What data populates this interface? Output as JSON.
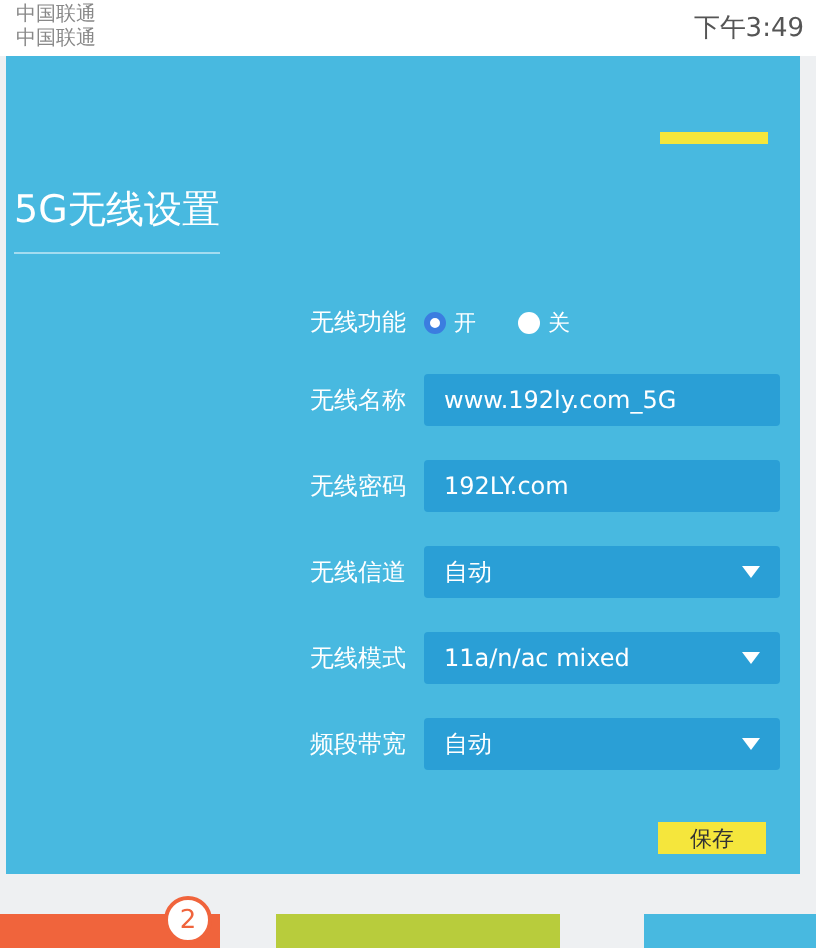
{
  "status_bar": {
    "carriers": [
      "中国联通",
      "中国联通"
    ],
    "time": "下午3:49"
  },
  "section": {
    "title": "5G无线设置"
  },
  "form": {
    "rows": [
      {
        "kind": "radio",
        "label": "无线功能",
        "options": [
          {
            "label": "开",
            "selected": true
          },
          {
            "label": "关",
            "selected": false
          }
        ]
      },
      {
        "kind": "input",
        "label": "无线名称",
        "value": "www.192ly.com_5G"
      },
      {
        "kind": "input",
        "label": "无线密码",
        "value": "192LY.com"
      },
      {
        "kind": "select",
        "label": "无线信道",
        "value": "自动"
      },
      {
        "kind": "select",
        "label": "无线模式",
        "value": "11a/n/ac mixed"
      },
      {
        "kind": "select",
        "label": "频段带宽",
        "value": "自动"
      }
    ],
    "save": "保存"
  },
  "steps": [
    {
      "label": "2",
      "color": "#f0643c"
    }
  ]
}
